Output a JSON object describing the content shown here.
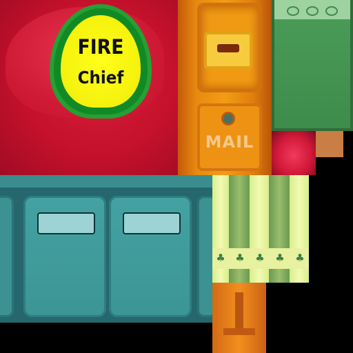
{
  "atlas": {
    "helmet_badge": {
      "line1": "FIRE",
      "line2": "Chief"
    },
    "mailbox_label": "MAIL"
  },
  "colors": {
    "helmet_red": "#c5112c",
    "badge_green": "#118a26",
    "badge_yellow": "#f5f20e",
    "mailbox_orange": "#e98a10",
    "sign_green": "#3f8b4c",
    "door_teal": "#3c9595",
    "awning_light": "#e7f1a0",
    "awning_dark": "#6a9a52"
  }
}
